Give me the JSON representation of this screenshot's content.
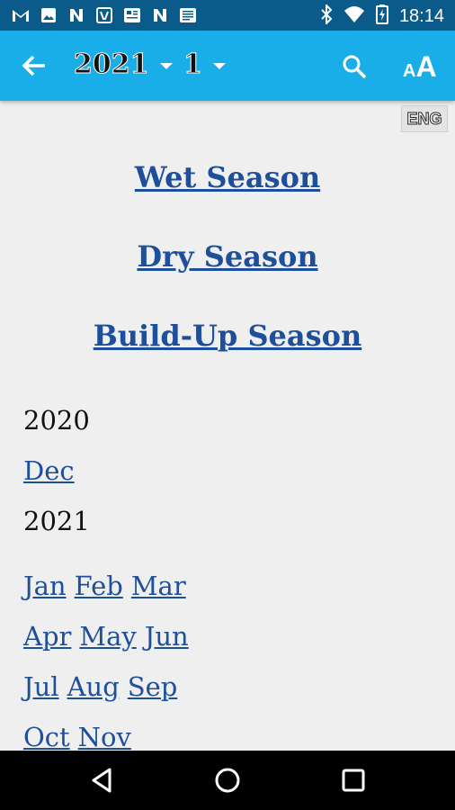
{
  "status_bar": {
    "time": "18:14",
    "left_icons": [
      "gmail-icon",
      "image-icon",
      "n-icon",
      "vfiles-icon",
      "news-icon",
      "n-icon",
      "news-icon"
    ],
    "right_icons": [
      "bluetooth-icon",
      "wifi-icon",
      "battery-icon"
    ]
  },
  "app_bar": {
    "back_icon": "arrow-left-icon",
    "year_selected": "2021",
    "month_selected": "1",
    "search_icon": "search-icon",
    "font_size_icon": "font-size-icon"
  },
  "language_button": "ENG",
  "seasons": [
    "Wet Season",
    "Dry Season",
    "Build-Up Season"
  ],
  "archive": [
    {
      "year": "2020",
      "months": [
        [
          "Dec"
        ]
      ]
    },
    {
      "year": "2021",
      "months": [
        [
          "Jan",
          "Feb",
          "Mar"
        ],
        [
          "Apr",
          "May",
          "Jun"
        ],
        [
          "Jul",
          "Aug",
          "Sep"
        ],
        [
          "Oct",
          "Nov"
        ]
      ]
    }
  ],
  "nav_bar": [
    "back-icon",
    "home-icon",
    "recents-icon"
  ],
  "colors": {
    "status_bar": "#0b5b8a",
    "app_bar": "#1aaee8",
    "link": "#1e4f9a",
    "background": "#efefef"
  }
}
